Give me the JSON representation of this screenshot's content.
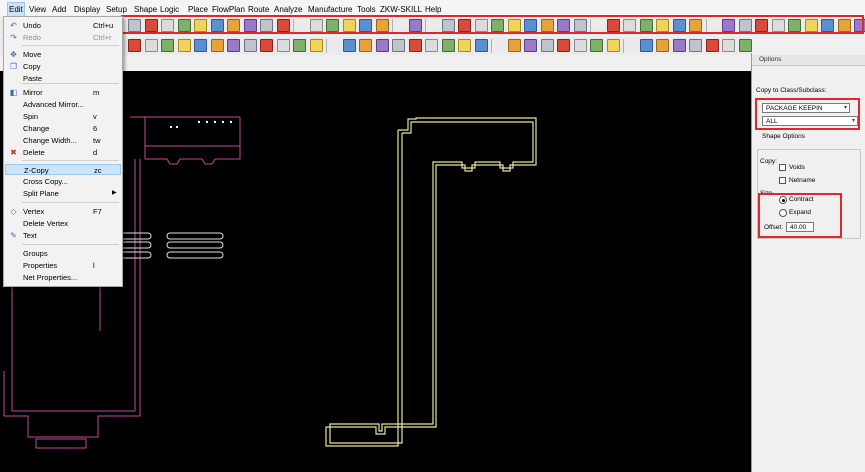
{
  "menubar": {
    "items": [
      "Edit",
      "View",
      "Add",
      "Display",
      "Setup",
      "Shape",
      "Logic",
      "Place",
      "FlowPlan",
      "Route",
      "Analyze",
      "Manufacture",
      "Tools",
      "ZKW-SKILL",
      "Help"
    ]
  },
  "edit_menu": {
    "items": [
      {
        "label": "Undo",
        "shortcut": "Ctrl+u",
        "icon": "undo-icon",
        "glyph": "↶"
      },
      {
        "label": "Redo",
        "shortcut": "Ctrl+r",
        "icon": "redo-icon",
        "glyph": "↷",
        "disabled": true
      },
      {
        "label": "Move",
        "shortcut": "",
        "icon": "move-icon",
        "glyph": "✥"
      },
      {
        "label": "Copy",
        "shortcut": "",
        "icon": "copy-icon",
        "glyph": "❐"
      },
      {
        "label": "Paste",
        "shortcut": ""
      },
      {
        "label": "Mirror",
        "shortcut": "m",
        "icon": "mirror-icon",
        "glyph": "◧"
      },
      {
        "label": "Advanced Mirror...",
        "shortcut": ""
      },
      {
        "label": "Spin",
        "shortcut": "v"
      },
      {
        "label": "Change",
        "shortcut": "6"
      },
      {
        "label": "Change Width...",
        "shortcut": "tw"
      },
      {
        "label": "Delete",
        "shortcut": "d",
        "icon": "delete-icon",
        "glyph": "✖"
      },
      {
        "label": "Z-Copy",
        "shortcut": "zc",
        "highlighted": true
      },
      {
        "label": "Cross Copy...",
        "shortcut": ""
      },
      {
        "label": "Split Plane",
        "shortcut": "",
        "submenu": true
      },
      {
        "label": "Vertex",
        "shortcut": "F7",
        "icon": "vertex-icon",
        "glyph": "◇"
      },
      {
        "label": "Delete Vertex",
        "shortcut": ""
      },
      {
        "label": "Text",
        "shortcut": "",
        "icon": "text-icon",
        "glyph": "✎"
      },
      {
        "label": "Groups",
        "shortcut": ""
      },
      {
        "label": "Properties",
        "shortcut": "l"
      },
      {
        "label": "Net Properties...",
        "shortcut": ""
      }
    ]
  },
  "options_panel": {
    "title": "Options",
    "copy_to_class_label": "Copy to Class/Subclass:",
    "class_value": "PACKAGE KEEPIN",
    "subclass_value": "ALL",
    "shape_options_label": "Shape Options",
    "copy_label": "Copy:",
    "voids_label": "Voids",
    "netname_label": "Netname",
    "size_label": "Size",
    "contract_label": "Contract",
    "expand_label": "Expand",
    "offset_label": "Offset:",
    "offset_value": "40.00",
    "voids_checked": false,
    "netname_checked": false,
    "size_selected": "Contract"
  },
  "colors": {
    "canvas": "#000000",
    "pink_outline": "#c04a9a",
    "yellow_outline": "#e8e2a0",
    "highlight_red": "#e3262c"
  }
}
